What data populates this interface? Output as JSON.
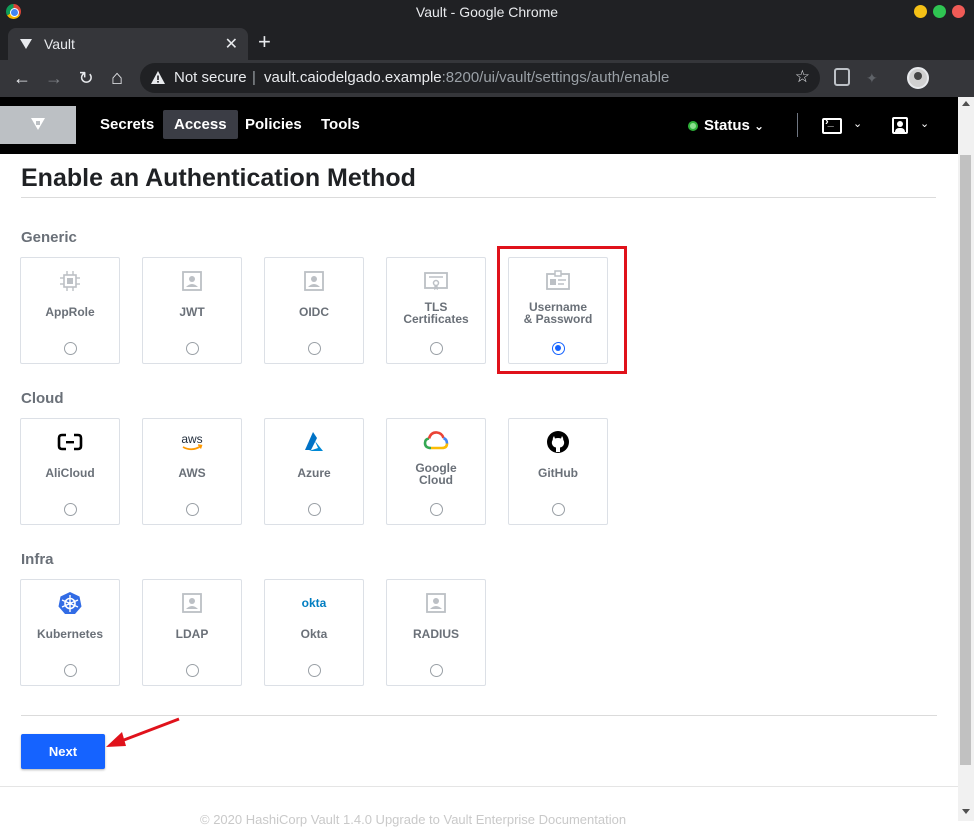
{
  "window": {
    "title": "Vault - Google Chrome"
  },
  "tab": {
    "title": "Vault",
    "close": "✕",
    "new": "+"
  },
  "toolbar": {
    "back": "←",
    "forward": "→",
    "reload": "↻",
    "home": "⌂",
    "not_secure": "Not secure",
    "separator": "|",
    "url_host": "vault.caiodelgado.example",
    "url_rest": ":8200/ui/vault/settings/auth/enable",
    "star": "☆",
    "menu": "⋮"
  },
  "vault_nav": {
    "items": [
      {
        "label": "Secrets",
        "active": false
      },
      {
        "label": "Access",
        "active": true
      },
      {
        "label": "Policies",
        "active": false
      },
      {
        "label": "Tools",
        "active": false
      }
    ],
    "status": "Status",
    "caret": "⌄"
  },
  "page": {
    "title": "Enable an Authentication Method",
    "next": "Next"
  },
  "sections": [
    {
      "label": "Generic",
      "methods": [
        {
          "label": "AppRole",
          "icon": "chip-icon",
          "selected": false
        },
        {
          "label": "JWT",
          "icon": "user-card-icon",
          "selected": false
        },
        {
          "label": "OIDC",
          "icon": "user-card-icon",
          "selected": false
        },
        {
          "label": "TLS Certificates",
          "icon": "certificate-icon",
          "selected": false
        },
        {
          "label": "Username & Password",
          "icon": "id-badge-icon",
          "selected": true
        }
      ]
    },
    {
      "label": "Cloud",
      "methods": [
        {
          "label": "AliCloud",
          "icon": "alicloud-icon",
          "selected": false
        },
        {
          "label": "AWS",
          "icon": "aws-icon",
          "selected": false
        },
        {
          "label": "Azure",
          "icon": "azure-icon",
          "selected": false
        },
        {
          "label": "Google Cloud",
          "icon": "google-cloud-icon",
          "selected": false
        },
        {
          "label": "GitHub",
          "icon": "github-icon",
          "selected": false
        }
      ]
    },
    {
      "label": "Infra",
      "methods": [
        {
          "label": "Kubernetes",
          "icon": "kubernetes-icon",
          "selected": false
        },
        {
          "label": "LDAP",
          "icon": "user-card-icon",
          "selected": false
        },
        {
          "label": "Okta",
          "icon": "okta-icon",
          "selected": false
        },
        {
          "label": "RADIUS",
          "icon": "user-card-icon",
          "selected": false
        }
      ]
    }
  ],
  "icon_text": {
    "aws": "aws",
    "okta": "okta"
  },
  "footer": "© 2020 HashiCorp  Vault 1.4.0  Upgrade to Vault Enterprise  Documentation",
  "colors": {
    "primary": "#1563ff",
    "highlight": "#e0121b",
    "header": "#000000"
  }
}
